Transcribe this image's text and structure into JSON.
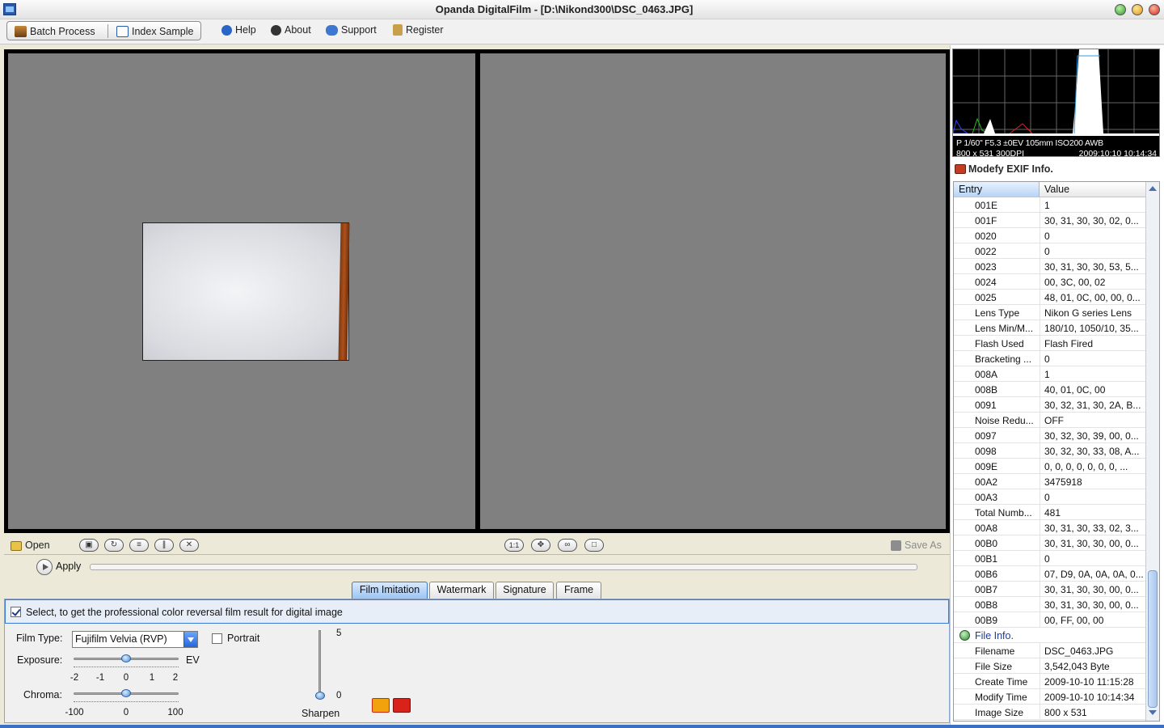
{
  "window": {
    "title": "Opanda DigitalFilm - [D:\\Nikond300\\DSC_0463.JPG]"
  },
  "toolbar": {
    "batch_process": "Batch Process",
    "index_sample": "Index Sample",
    "help": "Help",
    "about": "About",
    "support": "Support",
    "register": "Register"
  },
  "controls": {
    "open": "Open",
    "apply": "Apply",
    "save_as": "Save As",
    "zoom_1to1": "1:1"
  },
  "tabs": [
    {
      "label": "Film Imitation",
      "active": true
    },
    {
      "label": "Watermark",
      "active": false
    },
    {
      "label": "Signature",
      "active": false
    },
    {
      "label": "Frame",
      "active": false
    }
  ],
  "film": {
    "enable_text": "Select, to get the professional color reversal film result for digital image",
    "enable_checked": true,
    "film_type_label": "Film Type:",
    "film_type_value": "Fujifilm Velvia (RVP)",
    "portrait_label": "Portrait",
    "portrait_checked": false,
    "exposure_label": "Exposure:",
    "exposure_unit": "EV",
    "exposure_value": 0,
    "exposure_ticks": [
      "-2",
      "-1",
      "0",
      "1",
      "2"
    ],
    "chroma_label": "Chroma:",
    "chroma_value": 0,
    "chroma_ticks": [
      "-100",
      "0",
      "100"
    ],
    "sharpen_label": "Sharpen",
    "sharpen_max": "5",
    "sharpen_min": "0",
    "sharpen_value": 0
  },
  "histogram": {
    "info_line1": "P 1/60\" F5.3 ±0EV 105mm ISO200 AWB",
    "info_line2": "800 x 531  300DPI",
    "info_line3": "2009:10:10 10:14:34"
  },
  "exif": {
    "title": "Modefy EXIF Info.",
    "col_entry": "Entry",
    "col_value": "Value",
    "rows": [
      {
        "entry": "001E",
        "value": "1"
      },
      {
        "entry": "001F",
        "value": "30, 31, 30, 30, 02, 0..."
      },
      {
        "entry": "0020",
        "value": "0"
      },
      {
        "entry": "0022",
        "value": "0"
      },
      {
        "entry": "0023",
        "value": "30, 31, 30, 30, 53, 5..."
      },
      {
        "entry": "0024",
        "value": "00, 3C, 00, 02"
      },
      {
        "entry": "0025",
        "value": "48, 01, 0C, 00, 00, 0..."
      },
      {
        "entry": "Lens Type",
        "value": "Nikon G series Lens"
      },
      {
        "entry": "Lens Min/M...",
        "value": "180/10, 1050/10, 35..."
      },
      {
        "entry": "Flash Used",
        "value": "Flash Fired"
      },
      {
        "entry": "Bracketing ...",
        "value": "0"
      },
      {
        "entry": "008A",
        "value": "1"
      },
      {
        "entry": "008B",
        "value": "40, 01, 0C, 00"
      },
      {
        "entry": "0091",
        "value": "30, 32, 31, 30, 2A, B..."
      },
      {
        "entry": "Noise Redu...",
        "value": "OFF"
      },
      {
        "entry": "0097",
        "value": "30, 32, 30, 39, 00, 0..."
      },
      {
        "entry": "0098",
        "value": "30, 32, 30, 33, 08, A..."
      },
      {
        "entry": "009E",
        "value": "0, 0, 0, 0, 0, 0, 0, ..."
      },
      {
        "entry": "00A2",
        "value": "3475918"
      },
      {
        "entry": "00A3",
        "value": "0"
      },
      {
        "entry": "Total Numb...",
        "value": "481"
      },
      {
        "entry": "00A8",
        "value": "30, 31, 30, 33, 02, 3..."
      },
      {
        "entry": "00B0",
        "value": "30, 31, 30, 30, 00, 0..."
      },
      {
        "entry": "00B1",
        "value": "0"
      },
      {
        "entry": "00B6",
        "value": "07, D9, 0A, 0A, 0A, 0..."
      },
      {
        "entry": "00B7",
        "value": "30, 31, 30, 30, 00, 0..."
      },
      {
        "entry": "00B8",
        "value": "30, 31, 30, 30, 00, 0..."
      },
      {
        "entry": "00B9",
        "value": "00, FF, 00, 00"
      }
    ],
    "file_info_label": "File Info.",
    "file_rows": [
      {
        "entry": "Filename",
        "value": "DSC_0463.JPG"
      },
      {
        "entry": "File Size",
        "value": "3,542,043 Byte"
      },
      {
        "entry": "Create Time",
        "value": "2009-10-10 11:15:28"
      },
      {
        "entry": "Modify Time",
        "value": "2009-10-10 10:14:34"
      },
      {
        "entry": "Image Size",
        "value": "800 x 531"
      }
    ]
  }
}
